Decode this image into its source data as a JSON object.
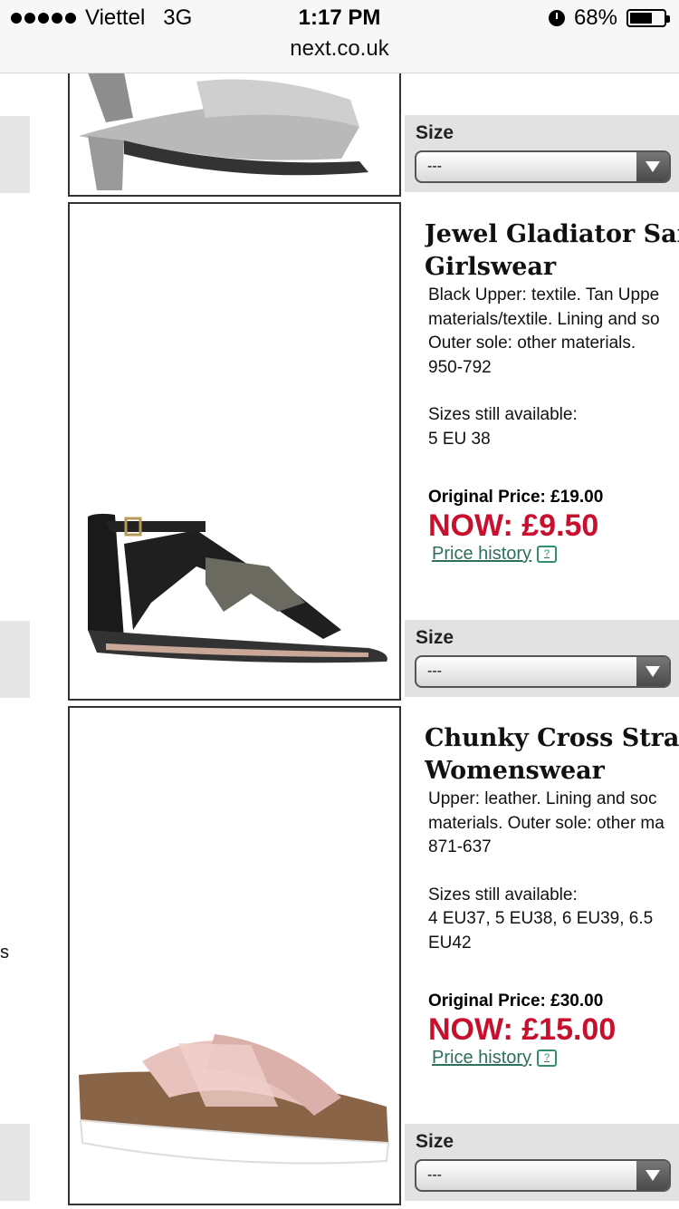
{
  "status_bar": {
    "carrier": "Viettel",
    "network": "3G",
    "time": "1:17 PM",
    "battery": "68%",
    "battery_level": 0.68,
    "url": "next.co.uk"
  },
  "size_bars": [
    {
      "label": "Size",
      "value": "---"
    },
    {
      "label": "Size",
      "value": "---"
    },
    {
      "label": "Size",
      "value": "---"
    }
  ],
  "products": [
    {
      "title_line1": "Jewel Gladiator San",
      "title_line2": "Girlswear",
      "desc": [
        "Black Upper: textile. Tan Uppe",
        "materials/textile. Lining and so",
        "Outer sole: other materials.",
        "950-792"
      ],
      "sizes_label": "Sizes still available:",
      "sizes": [
        "5 EU 38"
      ],
      "original_price": "Original Price: £19.00",
      "now_price": "NOW: £9.50",
      "history": "Price history"
    },
    {
      "title_line1": "Chunky Cross Strap",
      "title_line2": "Womenswear",
      "desc": [
        "Upper: leather. Lining and soc",
        "materials. Outer sole: other ma",
        "871-637"
      ],
      "sizes_label": "Sizes still available:",
      "sizes": [
        "4 EU37, 5 EU38, 6 EU39, 6.5",
        "EU42"
      ],
      "original_price": "Original Price: £30.00",
      "now_price": "NOW: £15.00",
      "history": "Price history"
    }
  ],
  "edge_glyph": "s",
  "colors": {
    "sale": "#c8102e",
    "link": "#2f6f5e",
    "size_bar": "#e2e2e2"
  }
}
